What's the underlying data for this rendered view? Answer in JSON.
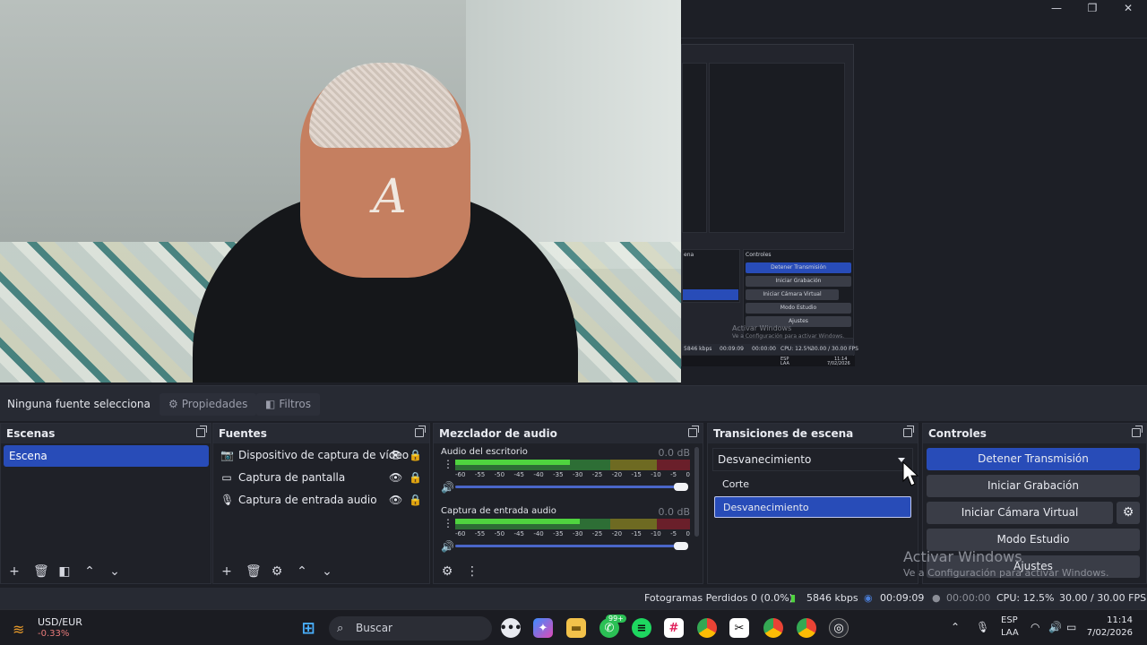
{
  "window": {
    "minimize_glyph": "—",
    "maximize_glyph": "❐",
    "close_glyph": "✕"
  },
  "nested_preview": {
    "controls_title": "Controles",
    "scenes_title": "ena",
    "btn_stop": "Detener Transmisión",
    "btn_record": "Iniciar Grabación",
    "btn_vcam": "Iniciar Cámara Virtual",
    "btn_studio": "Modo Estudio",
    "btn_settings": "Ajustes",
    "watermark_title": "Activar Windows",
    "watermark_sub": "Ve a Configuración para activar Windows.",
    "status_kbps": "5846 kbps",
    "status_time": "00:09:09",
    "status_time2": "00:00:00",
    "status_cpu": "CPU: 12.5%",
    "status_fps": "30.00 / 30.00 FPS",
    "clock_time": "11:14",
    "clock_date": "7/02/2026",
    "lang": "ESP",
    "lang2": "LAA"
  },
  "source_toolbar": {
    "no_selection": "Ninguna fuente selecciona",
    "properties": "Propiedades",
    "filters": "Filtros"
  },
  "scenes": {
    "title": "Escenas",
    "items": [
      "Escena"
    ]
  },
  "sources": {
    "title": "Fuentes",
    "items": [
      {
        "label": "Dispositivo de captura de vídeo",
        "icon": "camera-icon"
      },
      {
        "label": "Captura de pantalla",
        "icon": "monitor-icon"
      },
      {
        "label": "Captura de entrada audio",
        "icon": "microphone-icon"
      }
    ]
  },
  "mixer": {
    "title": "Mezclador de audio",
    "channels": [
      {
        "name": "Audio del escritorio",
        "db": "0.0 dB",
        "level": 0.49
      },
      {
        "name": "Captura de entrada audio",
        "db": "0.0 dB",
        "level": 0.53
      }
    ],
    "ticks": [
      "-60",
      "-55",
      "-50",
      "-45",
      "-40",
      "-35",
      "-30",
      "-25",
      "-20",
      "-15",
      "-10",
      "-5",
      "0"
    ]
  },
  "transitions": {
    "title": "Transiciones de escena",
    "selected": "Desvanecimiento",
    "options": [
      "Corte",
      "Desvanecimiento"
    ]
  },
  "controls": {
    "title": "Controles",
    "stop_stream": "Detener Transmisión",
    "start_record": "Iniciar Grabación",
    "start_vcam": "Iniciar Cámara Virtual",
    "studio_mode": "Modo Estudio",
    "settings": "Ajustes"
  },
  "activation": {
    "title": "Activar Windows",
    "subtitle": "Ve a Configuración para activar Windows."
  },
  "statusbar": {
    "dropped": "Fotogramas Perdidos 0 (0.0%)",
    "bitrate": "5846 kbps",
    "stream_time": "00:09:09",
    "record_time": "00:00:00",
    "cpu": "CPU: 12.5%",
    "fps": "30.00 / 30.00 FPS"
  },
  "taskbar": {
    "ticker_name": "USD/EUR",
    "ticker_change": "-0.33%",
    "search_placeholder": "Buscar",
    "whatsapp_badge": "99+",
    "lang": "ESP",
    "lang2": "LAA",
    "time": "11:14",
    "date": "7/02/2026"
  },
  "colors": {
    "accent": "#284cb8",
    "panel": "#1f2128",
    "header": "#272a33"
  }
}
